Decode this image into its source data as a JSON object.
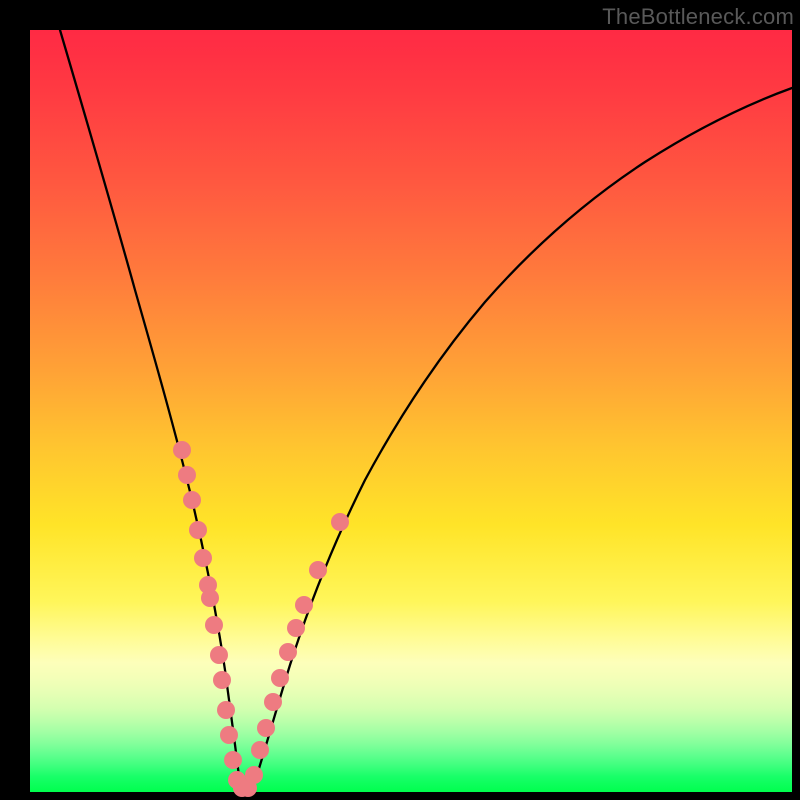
{
  "watermark": "TheBottleneck.com",
  "chart_data": {
    "type": "line",
    "title": "",
    "xlabel": "",
    "ylabel": "",
    "xlim": [
      0,
      100
    ],
    "ylim": [
      0,
      100
    ],
    "grid": false,
    "legend": false,
    "description": "V-shaped bottleneck curve over a vertical red-to-green gradient. Y axis suggests bottleneck percentage (100 top / red, 0 bottom / green). Minimum near x≈27.",
    "series": [
      {
        "name": "bottleneck-curve",
        "x": [
          4,
          6,
          8,
          10,
          12,
          14,
          16,
          18,
          20,
          22,
          24,
          25,
          26,
          27,
          28,
          29,
          30,
          32,
          34,
          36,
          38,
          40,
          45,
          50,
          55,
          60,
          65,
          70,
          75,
          80,
          85,
          90,
          95,
          100
        ],
        "y": [
          100,
          93,
          86,
          79,
          72,
          65,
          58,
          50,
          42,
          33,
          22,
          15,
          8,
          2,
          2,
          6,
          11,
          20,
          27,
          33,
          38,
          42,
          51,
          58,
          63,
          68,
          72,
          75,
          78,
          80,
          82,
          84,
          85.5,
          87
        ]
      }
    ],
    "markers": {
      "name": "highlighted-points",
      "color": "#ee7b81",
      "x": [
        18.5,
        19.2,
        20.0,
        21.0,
        22.0,
        22.8,
        23.0,
        23.8,
        24.5,
        25.0,
        25.8,
        26.5,
        27.3,
        28.0,
        28.8,
        29.5,
        30.0,
        30.8,
        31.5,
        32.0,
        33.0,
        34.0,
        35.0,
        36.5
      ],
      "y": [
        47,
        44,
        41,
        36,
        31,
        27,
        26,
        22,
        17,
        13,
        8,
        5,
        2,
        2,
        2,
        5,
        8,
        12,
        16,
        19,
        23,
        27,
        30,
        35
      ]
    },
    "gradient_stops": [
      {
        "pos": 0.0,
        "color": "#ff2a44"
      },
      {
        "pos": 0.32,
        "color": "#ff7a3c"
      },
      {
        "pos": 0.65,
        "color": "#ffe428"
      },
      {
        "pos": 0.85,
        "color": "#f4ffb8"
      },
      {
        "pos": 1.0,
        "color": "#00ff4e"
      }
    ]
  }
}
